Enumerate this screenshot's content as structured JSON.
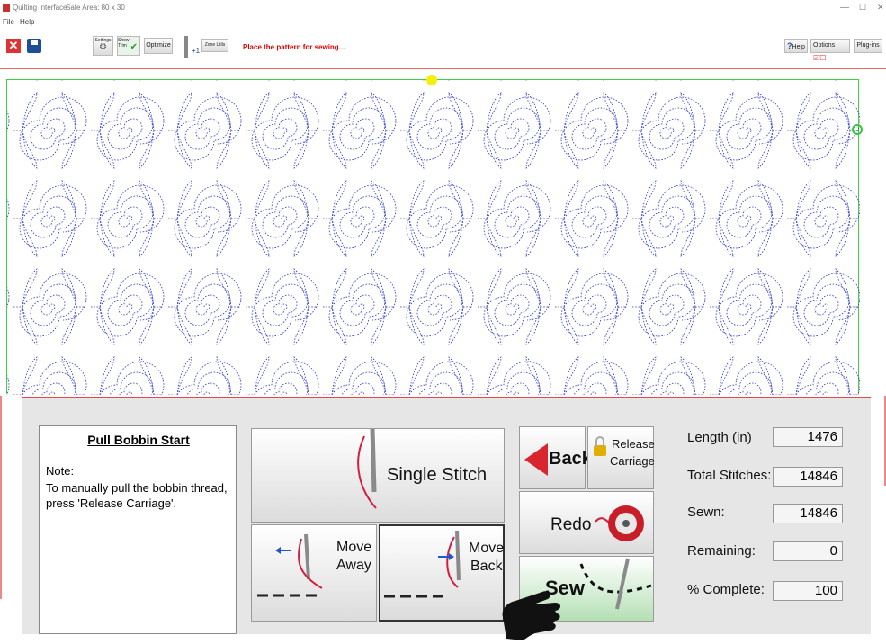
{
  "window": {
    "title": "Quilting Interface",
    "subtitle": "Safe Area: 80 x 30",
    "controls": {
      "minimize": "—",
      "maximize": "☐",
      "close": "✕"
    }
  },
  "menu": {
    "file": "File",
    "help": "Help"
  },
  "toolbar": {
    "settings": "Settings",
    "show_trim": "Show Trim",
    "optimize": "Optimize",
    "plus_one": "+1",
    "zone_utils": "Zone Utils",
    "status": "Place the pattern for sewing...",
    "help": "Help",
    "help_prefix": "?",
    "options": "Options",
    "plugins": "Plug-ins"
  },
  "notes": {
    "title": "Pull Bobbin Start",
    "label": "Note:",
    "body": "To manually pull the bobbin thread, press 'Release Carriage'."
  },
  "buttons": {
    "single_stitch": "Single Stitch",
    "move_away": [
      "Move",
      "Away"
    ],
    "move_back": [
      "Move",
      "Back"
    ],
    "back": "Back",
    "release_carriage": [
      "Release",
      "Carriage"
    ],
    "redo": "Redo",
    "sew": "Sew"
  },
  "stats": [
    {
      "label": "Length (in)",
      "value": "1476"
    },
    {
      "label": "Total Stitches:",
      "value": "14846"
    },
    {
      "label": "Sewn:",
      "value": "14846"
    },
    {
      "label": "Remaining:",
      "value": "0"
    },
    {
      "label": "% Complete:",
      "value": "100"
    }
  ],
  "colors": {
    "pattern_stitch": "#2a37c8",
    "safe_area_border": "#3fd13f",
    "status_text": "#e00000",
    "panel_border": "#e24a4a",
    "sew_button": "#b4e0b4"
  }
}
